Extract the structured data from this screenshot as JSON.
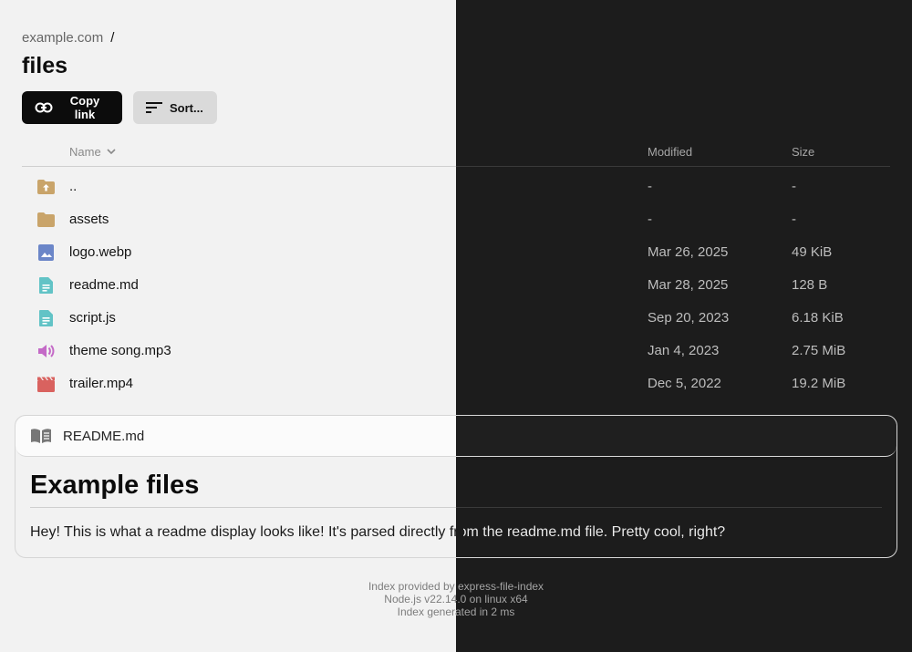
{
  "header": {
    "breadcrumb_site": "example.com",
    "breadcrumb_sep": "/",
    "title": "files"
  },
  "toolbar": {
    "copy_label": "Copy link",
    "sort_label": "Sort..."
  },
  "table": {
    "col_name": "Name",
    "col_modified": "Modified",
    "col_size": "Size",
    "rows": [
      {
        "name": "..",
        "modified": "-",
        "size": "-",
        "icon": "folder-up-icon"
      },
      {
        "name": "assets",
        "modified": "-",
        "size": "-",
        "icon": "folder-icon"
      },
      {
        "name": "logo.webp",
        "modified": "Mar 26, 2025",
        "size": "49 KiB",
        "icon": "image-file-icon"
      },
      {
        "name": "readme.md",
        "modified": "Mar 28, 2025",
        "size": "128 B",
        "icon": "document-icon"
      },
      {
        "name": "script.js",
        "modified": "Sep 20, 2023",
        "size": "6.18 KiB",
        "icon": "document-icon"
      },
      {
        "name": "theme song.mp3",
        "modified": "Jan 4, 2023",
        "size": "2.75 MiB",
        "icon": "audio-icon"
      },
      {
        "name": "trailer.mp4",
        "modified": "Dec 5, 2022",
        "size": "19.2 MiB",
        "icon": "video-icon"
      }
    ]
  },
  "readme": {
    "filename": "README.md",
    "heading": "Example files",
    "body": "Hey! This is what a readme display looks like! It's parsed directly from the readme.md file. Pretty cool, right?"
  },
  "footer": {
    "provided_prefix": "Index provided by ",
    "provided_link": "express-file-index",
    "runtime": "Node.js v22.14.0 on linux x64",
    "generated": "Index generated in 2 ms"
  },
  "colors": {
    "light_bg": "#f2f2f2",
    "dark_bg": "#1c1c1c",
    "folder": "#c9a46a",
    "image": "#6b86c8",
    "document": "#62c3c6",
    "audio": "#c46ac7",
    "video": "#d9625f"
  }
}
